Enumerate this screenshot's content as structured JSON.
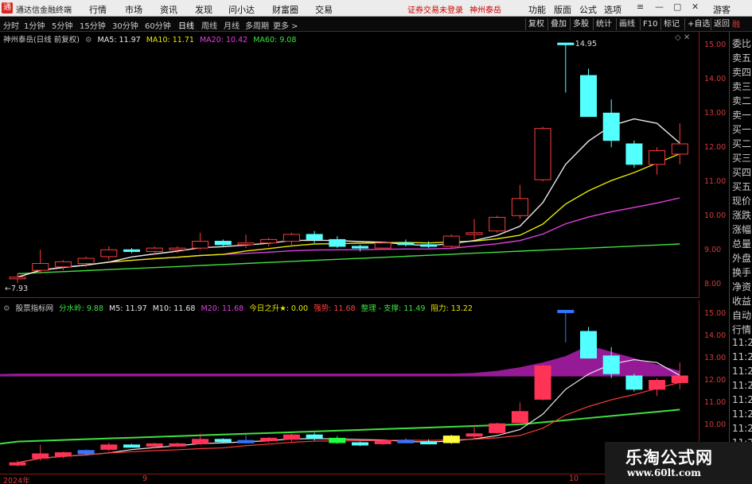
{
  "titlebar": {
    "app_title": "通达信金融终端",
    "menus": [
      "行情",
      "市场",
      "资讯",
      "发现",
      "问小达",
      "财富圈",
      "交易"
    ],
    "notice": "证券交易未登录",
    "stock_name": "神州泰岳",
    "right_buttons": [
      "功能",
      "版面",
      "公式",
      "选项"
    ],
    "guest_label": "游客"
  },
  "toolbar": {
    "periods": [
      "分时",
      "1分钟",
      "5分钟",
      "15分钟",
      "30分钟",
      "60分钟",
      "日线",
      "周线",
      "月线",
      "多周期",
      "更多 >"
    ],
    "active_period": "日线",
    "right_buttons": [
      "复权",
      "叠加",
      "多股",
      "统计",
      "画线",
      "F10",
      "标记",
      "+自选",
      "返回"
    ]
  },
  "main_chart": {
    "title": "神州泰岳(日线 前复权)",
    "ma_labels": [
      {
        "text": "MA5: 11.97",
        "color": "#e8e8e8"
      },
      {
        "text": "MA10: 11.71",
        "color": "#e8e800"
      },
      {
        "text": "MA20: 10.42",
        "color": "#e040e0"
      },
      {
        "text": "MA60: 9.08",
        "color": "#40e040"
      }
    ],
    "high_label": "14.95",
    "low_label": "7.93",
    "y_ticks": [
      "15.00",
      "14.00",
      "13.00",
      "12.00",
      "11.00",
      "10.00",
      "9.00",
      "8.00"
    ]
  },
  "sub_chart": {
    "title": "股票指标网",
    "labels": [
      {
        "text": "分水岭: 9.88",
        "color": "#40e040"
      },
      {
        "text": "M5: 11.97",
        "color": "#e8e8e8"
      },
      {
        "text": "M10: 11.68",
        "color": "#e8e8e8"
      },
      {
        "text": "M20: 11.68",
        "color": "#e040e0"
      },
      {
        "text": "今日之升★: 0.00",
        "color": "#e8e800"
      },
      {
        "text": "强势: 11.68",
        "color": "#ff4040"
      },
      {
        "text": "整理 - 支撑: 11.49",
        "color": "#40e040"
      },
      {
        "text": "阻力: 13.22",
        "color": "#e8e800"
      }
    ],
    "y_ticks": [
      "15.00",
      "14.00",
      "13.00",
      "12.00",
      "11.00",
      "10.00",
      "9.00"
    ]
  },
  "side_menu": {
    "badge": "融",
    "items": [
      "委比",
      "卖五",
      "卖四",
      "卖三",
      "卖二",
      "卖一",
      "买一",
      "买二",
      "买三",
      "买四",
      "买五",
      "现价",
      "涨跌",
      "涨幅",
      "总量",
      "外盘",
      "换手",
      "净资",
      "收益",
      "自动",
      "行情",
      "11:2",
      "11:2",
      "11:2",
      "11:2",
      "11:2",
      "11:2",
      "11:2",
      "11:2",
      "11:2",
      "11:2",
      "11:2"
    ]
  },
  "date_axis": {
    "labels": [
      "2024年",
      "9",
      "10"
    ]
  },
  "watermark": {
    "title": "乐淘公式网",
    "url": "www.60lt.com"
  },
  "chart_data": {
    "type": "candlestick",
    "series": [
      {
        "name": "OHLC",
        "values": [
          {
            "o": 8.05,
            "h": 8.2,
            "l": 7.93,
            "c": 8.1
          },
          {
            "o": 8.3,
            "h": 8.9,
            "l": 8.2,
            "c": 8.5
          },
          {
            "o": 8.4,
            "h": 8.6,
            "l": 8.3,
            "c": 8.55
          },
          {
            "o": 8.5,
            "h": 8.7,
            "l": 8.4,
            "c": 8.65
          },
          {
            "o": 8.7,
            "h": 9.0,
            "l": 8.6,
            "c": 8.9
          },
          {
            "o": 8.9,
            "h": 8.95,
            "l": 8.8,
            "c": 8.85
          },
          {
            "o": 8.85,
            "h": 9.0,
            "l": 8.75,
            "c": 8.95
          },
          {
            "o": 8.9,
            "h": 9.0,
            "l": 8.8,
            "c": 8.95
          },
          {
            "o": 8.95,
            "h": 9.4,
            "l": 8.9,
            "c": 9.15
          },
          {
            "o": 9.15,
            "h": 9.2,
            "l": 9.0,
            "c": 9.05
          },
          {
            "o": 9.05,
            "h": 9.35,
            "l": 8.95,
            "c": 9.1
          },
          {
            "o": 9.1,
            "h": 9.25,
            "l": 9.0,
            "c": 9.2
          },
          {
            "o": 9.15,
            "h": 9.4,
            "l": 9.05,
            "c": 9.35
          },
          {
            "o": 9.35,
            "h": 9.45,
            "l": 9.1,
            "c": 9.2
          },
          {
            "o": 9.2,
            "h": 9.3,
            "l": 8.95,
            "c": 9.0
          },
          {
            "o": 9.0,
            "h": 9.05,
            "l": 8.85,
            "c": 8.95
          },
          {
            "o": 8.95,
            "h": 9.15,
            "l": 8.9,
            "c": 9.1
          },
          {
            "o": 9.1,
            "h": 9.2,
            "l": 9.0,
            "c": 9.05
          },
          {
            "o": 9.05,
            "h": 9.15,
            "l": 8.95,
            "c": 9.0
          },
          {
            "o": 9.0,
            "h": 9.35,
            "l": 8.95,
            "c": 9.3
          },
          {
            "o": 9.35,
            "h": 9.8,
            "l": 9.2,
            "c": 9.4
          },
          {
            "o": 9.45,
            "h": 9.9,
            "l": 9.4,
            "c": 9.85
          },
          {
            "o": 9.9,
            "h": 10.8,
            "l": 9.8,
            "c": 10.4
          },
          {
            "o": 10.95,
            "h": 12.5,
            "l": 10.9,
            "c": 12.45
          },
          {
            "o": 14.95,
            "h": 14.95,
            "l": 13.5,
            "c": 14.9
          },
          {
            "o": 14.0,
            "h": 14.2,
            "l": 12.8,
            "c": 12.8
          },
          {
            "o": 12.9,
            "h": 13.3,
            "l": 11.9,
            "c": 12.1
          },
          {
            "o": 12.0,
            "h": 12.1,
            "l": 11.3,
            "c": 11.4
          },
          {
            "o": 11.4,
            "h": 11.9,
            "l": 11.1,
            "c": 11.8
          },
          {
            "o": 11.7,
            "h": 12.6,
            "l": 11.4,
            "c": 12.0
          }
        ]
      }
    ],
    "ylim": [
      7.6,
      15.2
    ]
  }
}
